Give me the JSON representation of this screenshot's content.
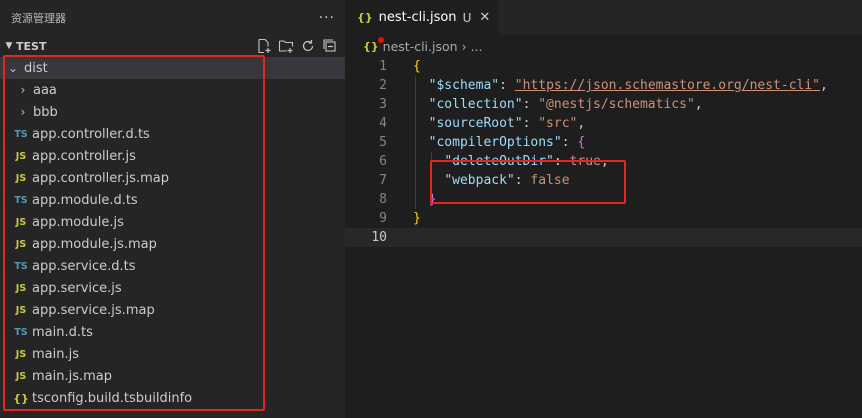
{
  "explorer": {
    "title": "资源管理器",
    "more": "···",
    "section": "TEST",
    "items": [
      {
        "label": "dist",
        "kind": "folder-open"
      },
      {
        "label": "aaa",
        "kind": "folder"
      },
      {
        "label": "bbb",
        "kind": "folder"
      },
      {
        "label": "app.controller.d.ts",
        "kind": "ts",
        "badge": "TS"
      },
      {
        "label": "app.controller.js",
        "kind": "js",
        "badge": "JS"
      },
      {
        "label": "app.controller.js.map",
        "kind": "js",
        "badge": "JS"
      },
      {
        "label": "app.module.d.ts",
        "kind": "ts",
        "badge": "TS"
      },
      {
        "label": "app.module.js",
        "kind": "js",
        "badge": "JS"
      },
      {
        "label": "app.module.js.map",
        "kind": "js",
        "badge": "JS"
      },
      {
        "label": "app.service.d.ts",
        "kind": "ts",
        "badge": "TS"
      },
      {
        "label": "app.service.js",
        "kind": "js",
        "badge": "JS"
      },
      {
        "label": "app.service.js.map",
        "kind": "js",
        "badge": "JS"
      },
      {
        "label": "main.d.ts",
        "kind": "ts",
        "badge": "TS"
      },
      {
        "label": "main.js",
        "kind": "js",
        "badge": "JS"
      },
      {
        "label": "main.js.map",
        "kind": "js",
        "badge": "JS"
      },
      {
        "label": "tsconfig.build.tsbuildinfo",
        "kind": "json",
        "badge": "{}"
      }
    ]
  },
  "editor": {
    "tab": {
      "icon": "{}",
      "name": "nest-cli.json",
      "status": "U",
      "close": "✕"
    },
    "breadcrumb": {
      "icon": "{}",
      "file": "nest-cli.json",
      "sep": "›",
      "more": "..."
    },
    "lines": [
      "1",
      "2",
      "3",
      "4",
      "5",
      "6",
      "7",
      "8",
      "9",
      "10"
    ],
    "code": {
      "open": "{",
      "schema_key": "\"$schema\"",
      "schema_val": "\"https://json.schemastore.org/nest-cli\"",
      "collection_key": "\"collection\"",
      "collection_val": "\"@nestjs/schematics\"",
      "sourceRoot_key": "\"sourceRoot\"",
      "sourceRoot_val": "\"src\"",
      "compiler_key": "\"compilerOptions\"",
      "compiler_open": "{",
      "deleteOutDir_key": "\"deleteOutDir\"",
      "deleteOutDir_val": "true",
      "webpack_key": "\"webpack\"",
      "webpack_val": "false",
      "compiler_close": "}",
      "close": "}"
    }
  },
  "colors": {
    "highlight_box": "#e5261e",
    "ts_badge": "#519aba",
    "js_badge": "#cbcb41"
  }
}
